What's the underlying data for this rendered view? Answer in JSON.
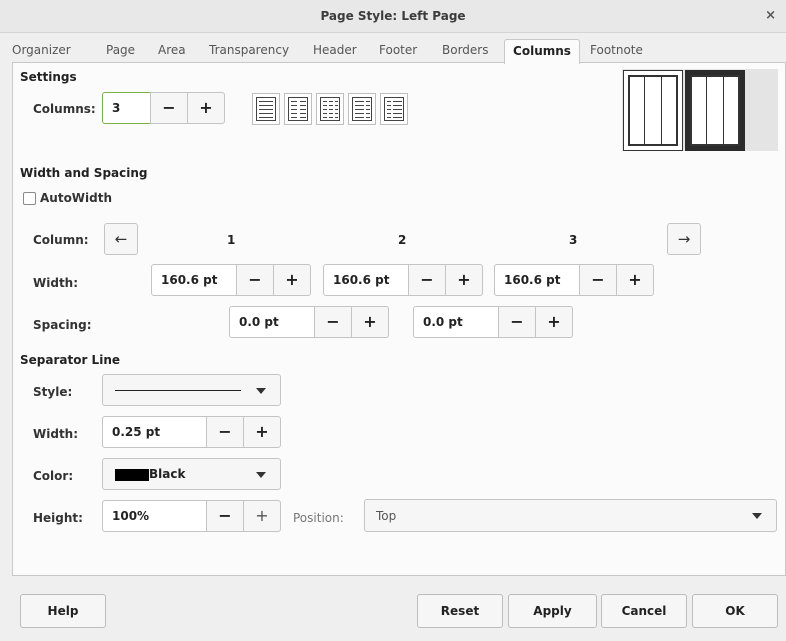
{
  "window": {
    "title": "Page Style: Left Page",
    "close_glyph": "×"
  },
  "tabs": [
    {
      "label": "Organizer"
    },
    {
      "label": "Page"
    },
    {
      "label": "Area"
    },
    {
      "label": "Transparency"
    },
    {
      "label": "Header"
    },
    {
      "label": "Footer"
    },
    {
      "label": "Borders"
    },
    {
      "label": "Columns",
      "active": true
    },
    {
      "label": "Footnote"
    }
  ],
  "settings": {
    "title": "Settings",
    "columns_label": "Columns:",
    "columns_value": "3",
    "minus": "−",
    "plus": "+"
  },
  "width_spacing": {
    "title": "Width and Spacing",
    "autowidth_label": "AutoWidth",
    "autowidth_checked": false,
    "column_label": "Column:",
    "prev_glyph": "←",
    "next_glyph": "→",
    "column_numbers": [
      "1",
      "2",
      "3"
    ],
    "width_label": "Width:",
    "widths": [
      "160.6 pt",
      "160.6 pt",
      "160.6 pt"
    ],
    "spacing_label": "Spacing:",
    "spacings": [
      "0.0 pt",
      "0.0 pt"
    ],
    "minus": "−",
    "plus": "+"
  },
  "separator": {
    "title": "Separator Line",
    "style_label": "Style:",
    "width_label": "Width:",
    "width_value": "0.25 pt",
    "color_label": "Color:",
    "color_name": "Black",
    "color_swatch": "#000000",
    "height_label": "Height:",
    "height_value": "100%",
    "position_label": "Position:",
    "position_value": "Top",
    "minus": "−",
    "plus": "+"
  },
  "footer": {
    "help": "Help",
    "reset": "Reset",
    "apply": "Apply",
    "cancel": "Cancel",
    "ok": "OK"
  },
  "colors": {
    "focus_border": "#79b04a",
    "preview_selected_bg": "#2b2b2b"
  }
}
